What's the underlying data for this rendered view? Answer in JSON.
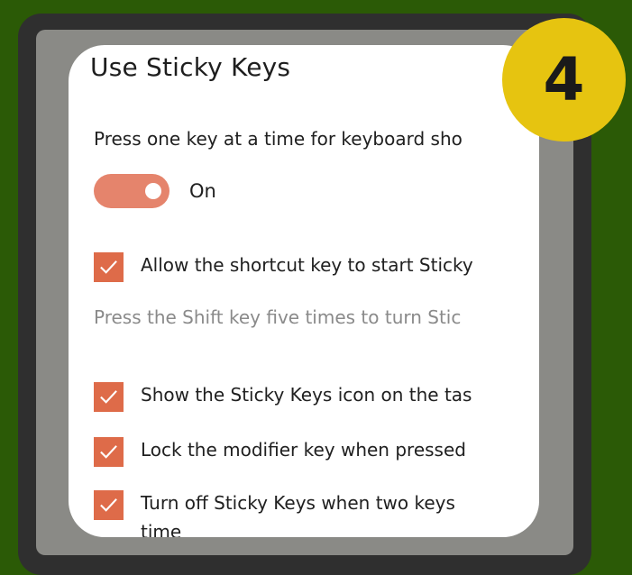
{
  "step_badge": {
    "number": "4"
  },
  "sticky_keys": {
    "title": "Use Sticky Keys",
    "description": "Press one key at a time for keyboard sho",
    "toggle_state_label": "On",
    "options": [
      {
        "label": "Allow the shortcut key to start Sticky",
        "checked": true
      },
      {
        "label": "Show the Sticky Keys icon on the tas",
        "checked": true
      },
      {
        "label": "Lock the modifier key when pressed",
        "checked": true
      },
      {
        "label": "Turn off Sticky Keys when two keys",
        "checked": true
      }
    ],
    "shortcut_hint": "Press the Shift key five times to turn Stic",
    "partial_word": "time"
  },
  "colors": {
    "accent": "#de6b49",
    "toggle_on": "#e5846c",
    "badge": "#e6c410",
    "background": "#2b5a06"
  },
  "icons": {
    "checkbox": "check-icon"
  }
}
